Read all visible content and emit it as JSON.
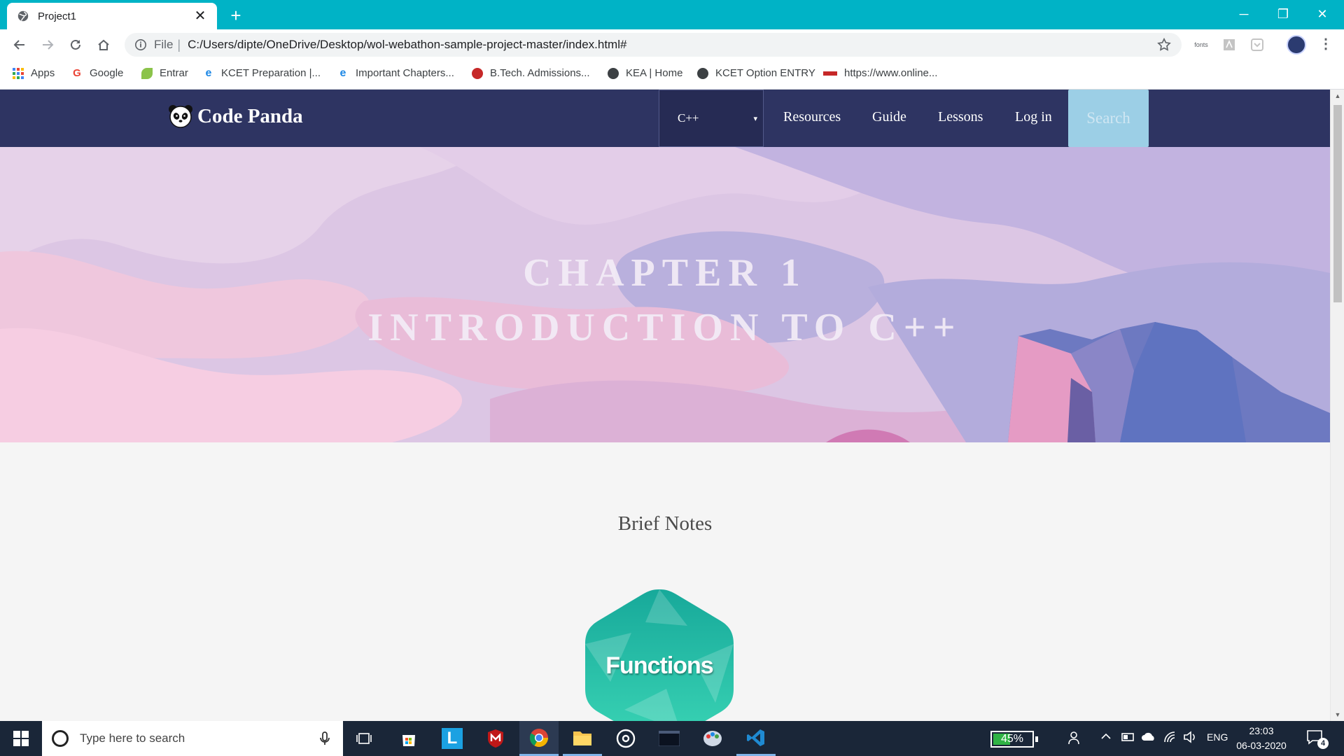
{
  "browser": {
    "tab": {
      "title": "Project1",
      "close_symbol": "✕"
    },
    "new_tab_symbol": "+",
    "window_controls": {
      "minimize": "─",
      "restore": "❐",
      "close": "✕"
    },
    "omnibox": {
      "scheme": "File",
      "separator": "|",
      "url": "C:/Users/dipte/OneDrive/Desktop/wol-webathon-sample-project-master/index.html#"
    },
    "extensions": {
      "fonts_label": "fonts"
    },
    "bookmarks": [
      {
        "label": "Apps",
        "icon": "apps-grid-icon",
        "color": "#4285f4"
      },
      {
        "label": "Google",
        "icon": "google-icon",
        "color": "#ea4335"
      },
      {
        "label": "Entrar",
        "icon": "leaf-icon",
        "color": "#7cb342"
      },
      {
        "label": "KCET Preparation |...",
        "icon": "edge-e-icon",
        "color": "#1e88e5"
      },
      {
        "label": "Important Chapters...",
        "icon": "edge-e-icon",
        "color": "#1e88e5"
      },
      {
        "label": "B.Tech. Admissions...",
        "icon": "bits-icon",
        "color": "#c62828"
      },
      {
        "label": "KEA | Home",
        "icon": "globe-icon",
        "color": "#3c4043"
      },
      {
        "label": "KCET Option ENTRY",
        "icon": "globe-icon",
        "color": "#3c4043"
      },
      {
        "label": "https://www.online...",
        "icon": "nsdl-icon",
        "color": "#c62828"
      }
    ]
  },
  "site": {
    "brand": "Code Panda",
    "language_select": {
      "selected": "C++",
      "caret": "▾"
    },
    "nav_links": [
      "Resources",
      "Guide",
      "Lessons",
      "Log in"
    ],
    "search_label": "Search",
    "hero": {
      "line1": "CHAPTER 1",
      "line2": "INTRODUCTION TO C++"
    },
    "section_title": "Brief Notes",
    "cards": [
      {
        "label": "Functions",
        "color": "#1fb9a3"
      }
    ]
  },
  "taskbar": {
    "search_placeholder": "Type here to search",
    "battery_percent": "45%",
    "battery_level": 0.45,
    "language": "ENG",
    "time": "23:03",
    "date": "06-03-2020",
    "notification_count": "4"
  }
}
